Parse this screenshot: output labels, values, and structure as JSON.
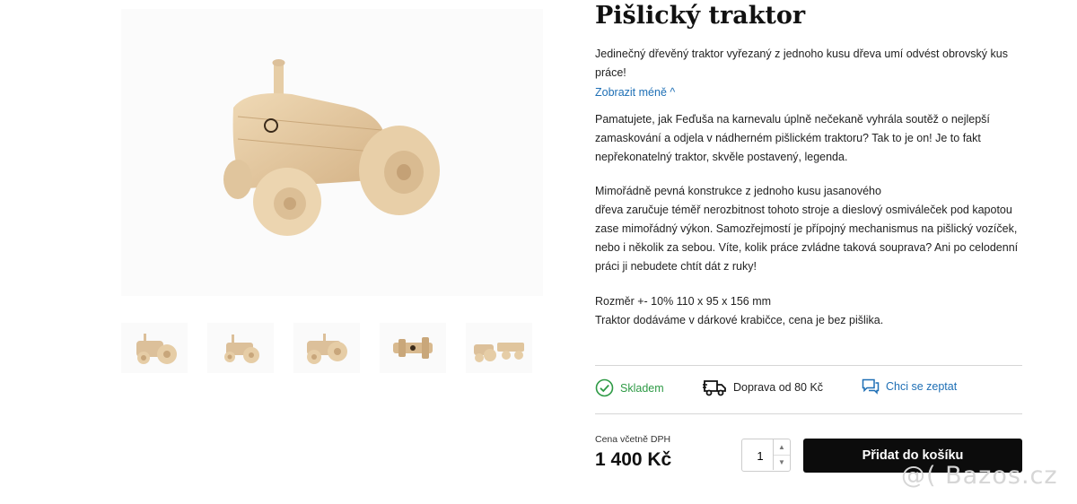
{
  "product": {
    "title": "Pišlický traktor",
    "intro": "Jedinečný dřevěný traktor vyřezaný z jednoho kusu dřeva umí odvést obrovský kus práce!",
    "toggle_label": "Zobrazit méně ^",
    "paragraph1": "Pamatujete, jak Feďuša na karnevalu úplně nečekaně vyhrála soutěž o nejlepší zamaskování a odjela v nádherném pišlickém traktoru? Tak to je on! Je to fakt nepřekonatelný traktor, skvěle postavený, legenda.",
    "paragraph2_line1": "Mimořádně pevná konstrukce z jednoho kusu jasanového",
    "paragraph2_rest": "dřeva zaručuje téměř nerozbitnost tohoto stroje a dieslový osmiváleček pod kapotou zase mimořádný výkon. Samozřejmostí je přípojný mechanismus na pišlický vozíček, nebo i několik za sebou. Víte, kolik práce zvládne taková souprava? Ani po celodenní práci ji nebudete chtít dát z ruky!",
    "dimensions": "Rozměr +- 10% 110 x 95 x 156 mm",
    "packaging": "Traktor dodáváme v dárkové krabičce, cena je bez pišlika."
  },
  "features": {
    "stock": "Skladem",
    "shipping": "Doprava od 80 Kč",
    "ask": "Chci se zeptat"
  },
  "purchase": {
    "price_label": "Cena včetně DPH",
    "price": "1 400 Kč",
    "quantity": "1",
    "add_to_cart": "Přidat do košíku"
  },
  "watermark": "@( Bazos.cz",
  "colors": {
    "stock_green": "#2e9a45",
    "link_blue": "#1e6fb5",
    "button_black": "#0c0c0c",
    "wood": "#e3c8a0"
  }
}
